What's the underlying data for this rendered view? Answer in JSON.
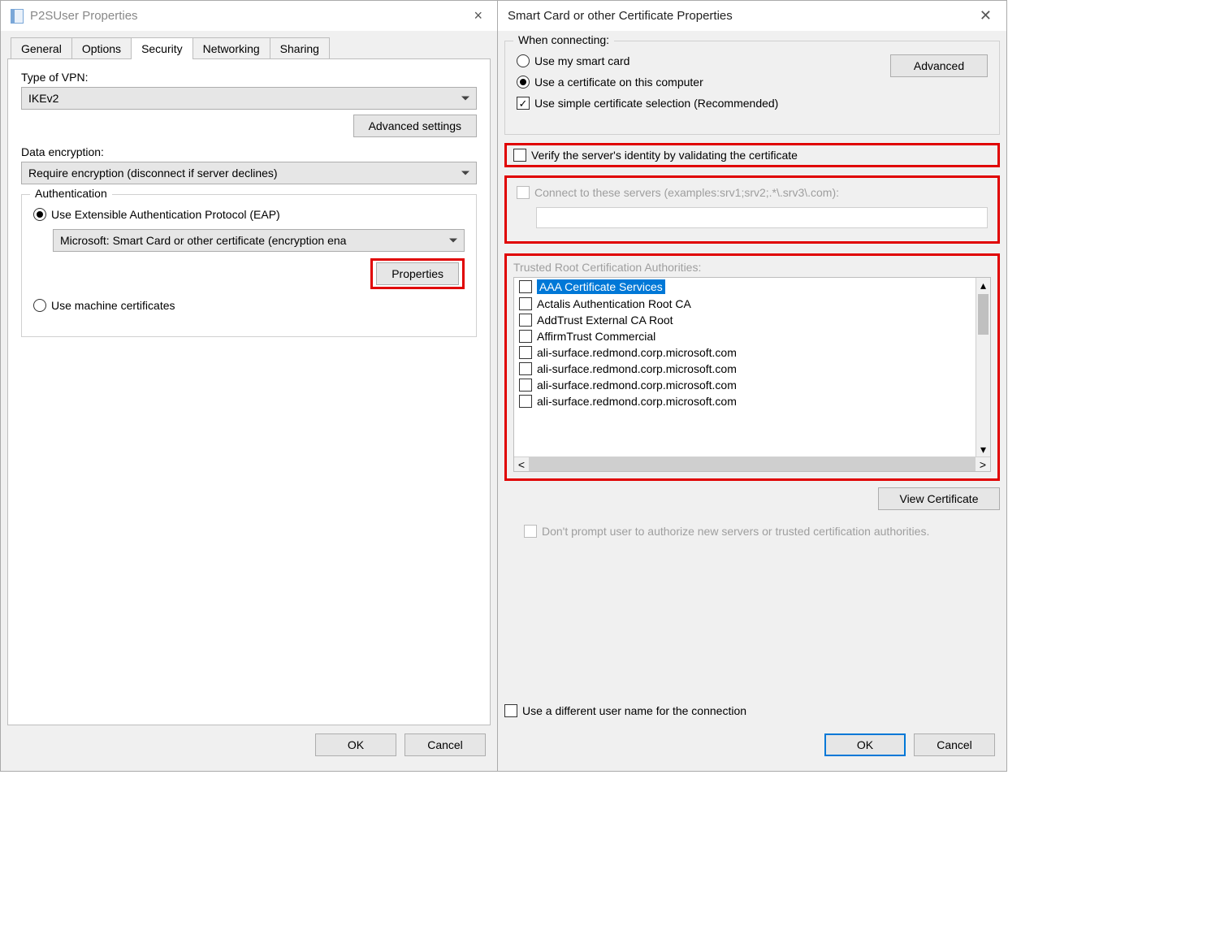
{
  "leftWindow": {
    "title": "P2SUser Properties",
    "tabs": [
      "General",
      "Options",
      "Security",
      "Networking",
      "Sharing"
    ],
    "activeTab": "Security",
    "security": {
      "vpnTypeLabel": "Type of VPN:",
      "vpnType": "IKEv2",
      "advancedSettings": "Advanced settings",
      "dataEncryptionLabel": "Data encryption:",
      "dataEncryption": "Require encryption (disconnect if server declines)",
      "auth": {
        "legend": "Authentication",
        "eapLabel": "Use Extensible Authentication Protocol (EAP)",
        "eapMethod": "Microsoft: Smart Card or other certificate (encryption ena",
        "propertiesBtn": "Properties",
        "machineCertsLabel": "Use machine certificates"
      },
      "ok": "OK",
      "cancel": "Cancel"
    }
  },
  "rightWindow": {
    "title": "Smart Card or other Certificate Properties",
    "whenConnecting": {
      "legend": "When connecting:",
      "smartCard": "Use my smart card",
      "useCert": "Use a certificate on this computer",
      "simpleSelection": "Use simple certificate selection (Recommended)",
      "advanced": "Advanced"
    },
    "verifyIdentity": "Verify the server's identity by validating the certificate",
    "connectServersLabel": "Connect to these servers (examples:srv1;srv2;.*\\.srv3\\.com):",
    "trustedRootLabel": "Trusted Root Certification Authorities:",
    "certAuthorities": [
      "AAA Certificate Services",
      "Actalis Authentication Root CA",
      "AddTrust External CA Root",
      "AffirmTrust Commercial",
      "ali-surface.redmond.corp.microsoft.com",
      "ali-surface.redmond.corp.microsoft.com",
      "ali-surface.redmond.corp.microsoft.com",
      "ali-surface.redmond.corp.microsoft.com"
    ],
    "viewCertificate": "View Certificate",
    "dontPrompt": "Don't prompt user to authorize new servers or trusted certification authorities.",
    "differentUserName": "Use a different user name for the connection",
    "ok": "OK",
    "cancel": "Cancel"
  }
}
